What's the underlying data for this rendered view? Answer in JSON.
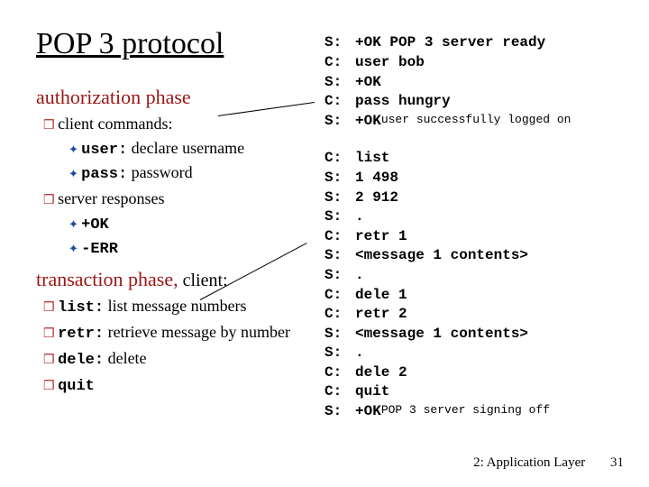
{
  "title": "POP 3 protocol",
  "left": {
    "auth_heading": "authorization phase",
    "client_commands_label": "client commands:",
    "user_cmd": "user:",
    "user_desc": " declare username",
    "pass_cmd": "pass:",
    "pass_desc": " password",
    "server_resp_label": "server responses",
    "ok": "+OK",
    "err": "-ERR",
    "trans_heading": "transaction phase,",
    "trans_suffix": " client:",
    "list_cmd": "list:",
    "list_desc": " list message numbers",
    "retr_cmd": "retr:",
    "retr_desc": " retrieve message by number",
    "dele_cmd": "dele:",
    "dele_desc": " delete",
    "quit_cmd": "quit"
  },
  "right": {
    "block1": [
      {
        "sc": "S:",
        "txt": "+OK POP 3 server ready"
      },
      {
        "sc": "C:",
        "txt": "user bob"
      },
      {
        "sc": "S:",
        "txt": "+OK"
      },
      {
        "sc": "C:",
        "txt": "pass hungry"
      },
      {
        "sc": "S:",
        "txt": "+OK",
        "small": " user successfully logged on"
      }
    ],
    "block2": [
      {
        "sc": "C:",
        "txt": "list"
      },
      {
        "sc": "S:",
        "txt": "1 498"
      },
      {
        "sc": "S:",
        "txt": "2 912"
      },
      {
        "sc": "S:",
        "txt": "."
      },
      {
        "sc": "C:",
        "txt": "retr 1"
      },
      {
        "sc": "S:",
        "txt": "<message 1 contents>"
      },
      {
        "sc": "S:",
        "txt": "."
      },
      {
        "sc": "C:",
        "txt": "dele 1"
      },
      {
        "sc": "C:",
        "txt": "retr 2"
      },
      {
        "sc": "S:",
        "txt": "<message 1 contents>"
      },
      {
        "sc": "S:",
        "txt": "."
      },
      {
        "sc": "C:",
        "txt": "dele 2"
      },
      {
        "sc": "C:",
        "txt": "quit"
      },
      {
        "sc": "S:",
        "txt": "+OK",
        "small": " POP 3 server signing off"
      }
    ]
  },
  "footer": {
    "label": "2: Application Layer",
    "page": "31"
  }
}
